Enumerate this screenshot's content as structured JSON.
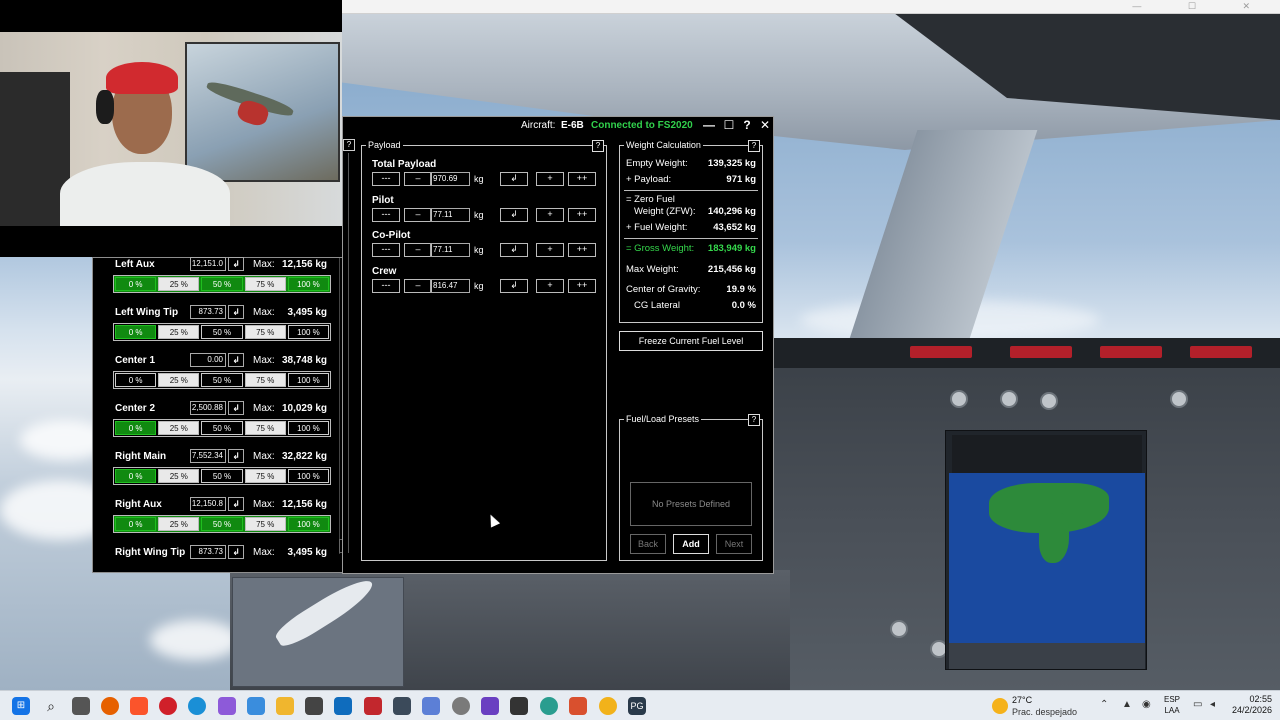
{
  "window": {
    "aircraft_label": "Aircraft:",
    "aircraft_name": "E-6B",
    "connection_status": "Connected to FS2020",
    "minimize": "—",
    "maximize": "☐",
    "help": "?",
    "close": "✕"
  },
  "payload": {
    "title": "Payload",
    "unit": "kg",
    "buttons": {
      "minus_minus": "---",
      "minus": "–",
      "enter": "↲",
      "plus": "+",
      "plus_plus": "++"
    },
    "rows": [
      {
        "name": "Total Payload",
        "value": "970.69"
      },
      {
        "name": "Pilot",
        "value": "77.11"
      },
      {
        "name": "Co-Pilot",
        "value": "77.11"
      },
      {
        "name": "Crew",
        "value": "816.47"
      }
    ]
  },
  "weight": {
    "title": "Weight Calculation",
    "empty_weight_label": "Empty Weight:",
    "empty_weight": "139,325 kg",
    "payload_label": "+ Payload:",
    "payload": "971 kg",
    "zfw_label_1": "= Zero Fuel",
    "zfw_label_2": "Weight (ZFW):",
    "zfw": "140,296 kg",
    "fuel_weight_label": "+ Fuel Weight:",
    "fuel_weight": "43,652 kg",
    "gross_weight_label": "= Gross Weight:",
    "gross_weight": "183,949 kg",
    "max_weight_label": "Max Weight:",
    "max_weight": "215,456 kg",
    "cg_label": "Center of Gravity:",
    "cg": "19.9 %",
    "cg_lateral_label": "CG Lateral",
    "cg_lateral": "0.0 %"
  },
  "freeze_label": "Freeze Current Fuel Level",
  "presets": {
    "title": "Fuel/Load Presets",
    "empty_text": "No Presets Defined",
    "back": "Back",
    "add": "Add",
    "next": "Next"
  },
  "fuel": {
    "max_label": "Max:",
    "pct_labels": [
      "0 %",
      "25 %",
      "50 %",
      "75 %",
      "100 %"
    ],
    "enter": "↲",
    "scroll_down": "⌄",
    "tanks": [
      {
        "name": "Left Aux",
        "value": "12,151.0",
        "max": "12,156 kg",
        "level_pct": 100
      },
      {
        "name": "Left Wing Tip",
        "value": "873.73",
        "max": "3,495 kg",
        "level_pct": 25
      },
      {
        "name": "Center 1",
        "value": "0.00",
        "max": "38,748 kg",
        "level_pct": 0
      },
      {
        "name": "Center 2",
        "value": "2,500.88",
        "max": "10,029 kg",
        "level_pct": 25
      },
      {
        "name": "Right Main",
        "value": "7,552.34",
        "max": "32,822 kg",
        "level_pct": 25
      },
      {
        "name": "Right Aux",
        "value": "12,150.8",
        "max": "12,156 kg",
        "level_pct": 100
      },
      {
        "name": "Right Wing Tip",
        "value": "873.73",
        "max": "3,495 kg",
        "level_pct": 25
      }
    ]
  },
  "taskbar": {
    "weather_temp": "27°C",
    "weather_desc": "Prac. despejado",
    "lang_1": "ESP",
    "lang_2": "LAA",
    "time": "02:55",
    "date": "24/2/2026"
  },
  "colors": {
    "connected": "#31d04c",
    "gross_weight": "#35d84c",
    "fuel_fill": "#108a10"
  }
}
